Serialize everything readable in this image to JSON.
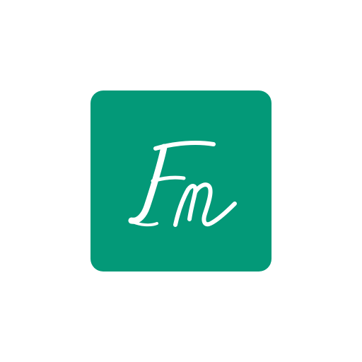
{
  "app_icon": {
    "name": "Fm",
    "background_color": "#039978",
    "glyph_color": "#ffffff",
    "icon": "fm-monogram-icon"
  }
}
